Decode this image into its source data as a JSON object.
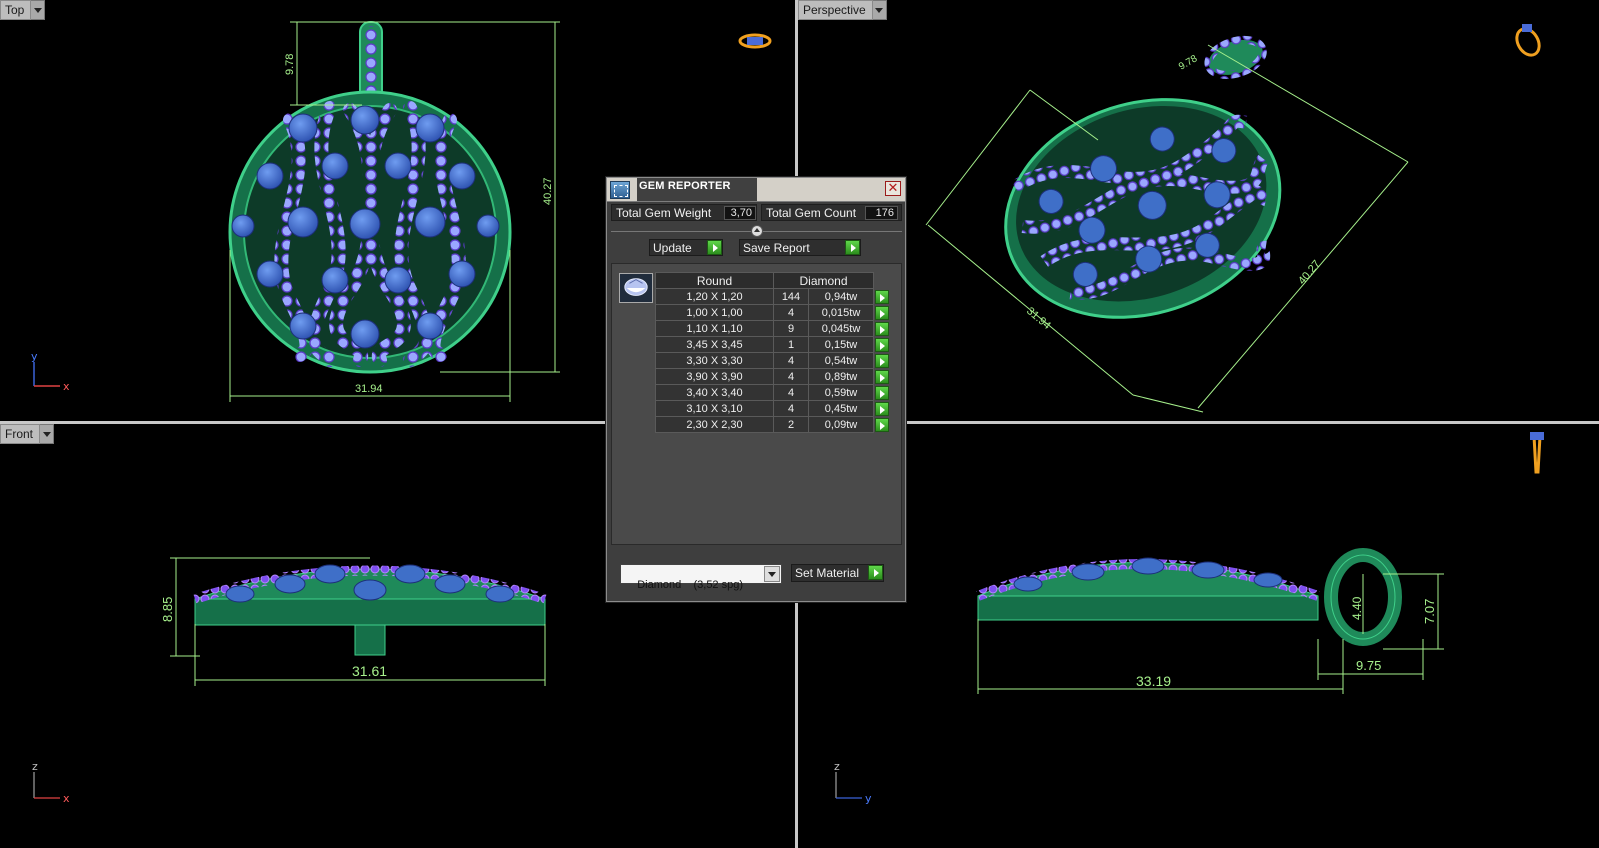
{
  "viewports": {
    "top": {
      "label": "Top",
      "dims": {
        "width": "31.94",
        "height": "40.27",
        "bail": "9.78"
      },
      "axes": {
        "h": "x",
        "v": "y"
      }
    },
    "perspective": {
      "label": "Perspective",
      "dims": {
        "a": "9.78",
        "b": "31.94",
        "c": "40.27"
      }
    },
    "front": {
      "label": "Front",
      "dims": {
        "width": "31.61",
        "height": "8.85"
      },
      "axes": {
        "h": "x",
        "v": "z"
      }
    },
    "side": {
      "dims": {
        "width": "33.19",
        "bail_w": "9.75",
        "bail_h": "7.07",
        "bail_inner": "4.40"
      },
      "axes": {
        "h": "y",
        "v": "z"
      }
    }
  },
  "gem_reporter": {
    "title": "GEM REPORTER",
    "close_glyph": "✕",
    "total_weight_label": "Total Gem Weight",
    "total_weight": "3,70",
    "total_count_label": "Total Gem Count",
    "total_count": "176",
    "update_label": "Update",
    "save_report_label": "Save Report",
    "table": {
      "col_shape": "Round",
      "col_material": "Diamond",
      "rows": [
        {
          "size": "1,20 X 1,20",
          "count": "144",
          "weight": "0,94tw"
        },
        {
          "size": "1,00 X 1,00",
          "count": "4",
          "weight": "0,015tw"
        },
        {
          "size": "1,10 X 1,10",
          "count": "9",
          "weight": "0,045tw"
        },
        {
          "size": "3,45 X 3,45",
          "count": "1",
          "weight": "0,15tw"
        },
        {
          "size": "3,30 X 3,30",
          "count": "4",
          "weight": "0,54tw"
        },
        {
          "size": "3,90 X 3,90",
          "count": "4",
          "weight": "0,89tw"
        },
        {
          "size": "3,40 X 3,40",
          "count": "4",
          "weight": "0,59tw"
        },
        {
          "size": "3,10 X 3,10",
          "count": "4",
          "weight": "0,45tw"
        },
        {
          "size": "2,30 X 2,30",
          "count": "2",
          "weight": "0,09tw"
        }
      ]
    },
    "material_select": "Diamond    (3,52 spg)",
    "set_material_label": "Set Material"
  },
  "colors": {
    "metal": "#1f8a5a",
    "gem": "#3f6fc8",
    "pave": "#8d9cf5",
    "prong": "#7b2fd0",
    "dimension": "#a6f08c",
    "gizmo": "#f0a020"
  }
}
